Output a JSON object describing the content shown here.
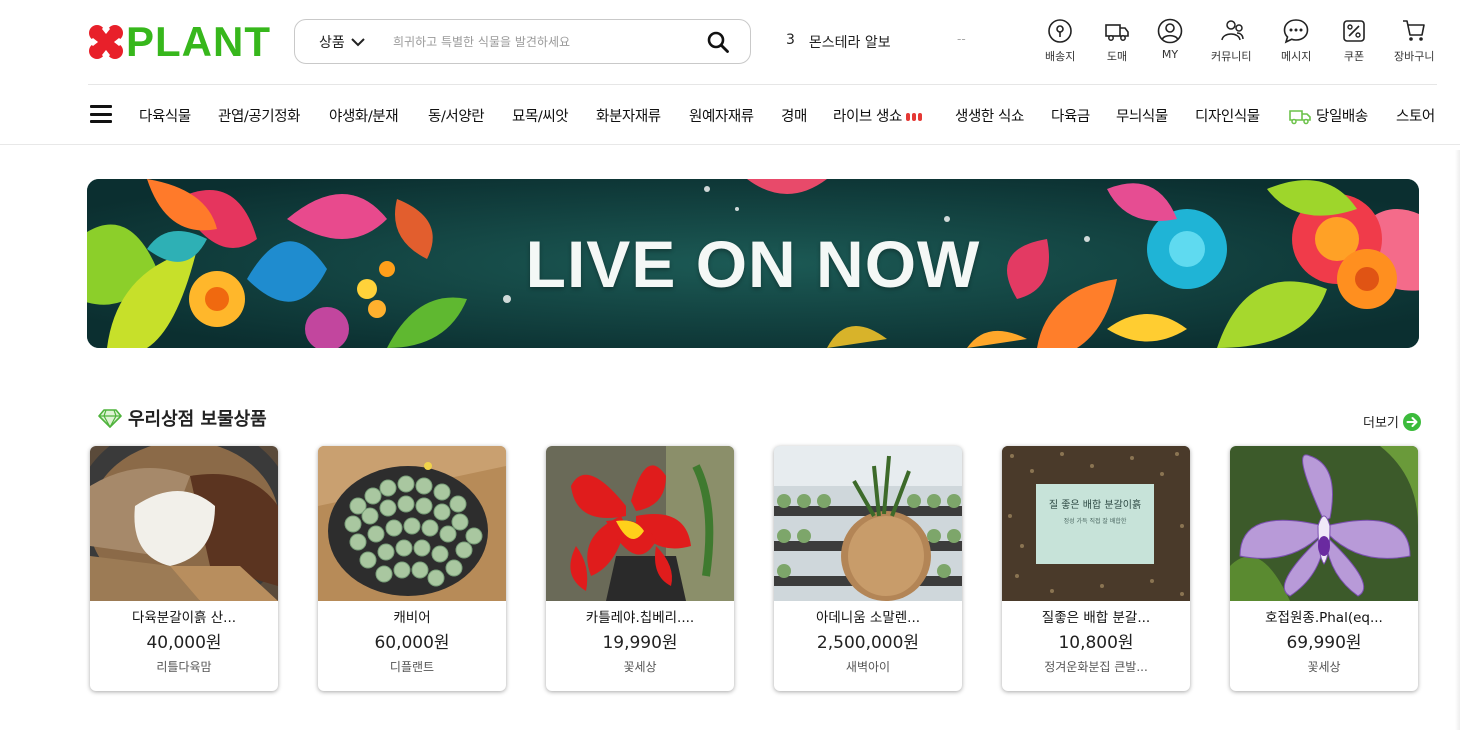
{
  "brand": {
    "logo_text": "PLANT",
    "accent": "#37b71c",
    "logo_x_color": "#e8202a"
  },
  "search": {
    "category": "상품",
    "placeholder": "희귀하고 특별한 식물을 발견하세요"
  },
  "trending": {
    "rank": "3",
    "keyword": "몬스테라 알보",
    "separator": "--"
  },
  "utility_menu": [
    {
      "label": "배송지",
      "icon": "map-pin-icon"
    },
    {
      "label": "도매",
      "icon": "truck-icon"
    },
    {
      "label": "MY",
      "icon": "user-icon"
    },
    {
      "label": "커뮤니티",
      "icon": "community-icon"
    },
    {
      "label": "메시지",
      "icon": "chat-icon"
    },
    {
      "label": "쿠폰",
      "icon": "coupon-icon"
    },
    {
      "label": "장바구니",
      "icon": "cart-icon"
    }
  ],
  "nav": {
    "items": [
      "다육식물",
      "관엽/공기정화",
      "야생화/분재",
      "동/서양란",
      "묘목/씨앗",
      "화분자재류",
      "원예자재류",
      "경매",
      "라이브 생쇼",
      "생생한 식쇼",
      "다육금",
      "무늬식물",
      "디자인식물",
      "당일배송",
      "스토어"
    ]
  },
  "banner": {
    "text": "LIVE ON NOW"
  },
  "section": {
    "title": "우리상점 보물상품",
    "more": "더보기"
  },
  "products": [
    {
      "name": "다육분갈이흙 산...",
      "price": "40,000원",
      "seller": "리틀다육맘"
    },
    {
      "name": "캐비어",
      "price": "60,000원",
      "seller": "디플랜트"
    },
    {
      "name": "카틀레야.칩베리....",
      "price": "19,990원",
      "seller": "꽃세상"
    },
    {
      "name": "아데니움 소말렌...",
      "price": "2,500,000원",
      "seller": "새벽아이"
    },
    {
      "name": "질좋은 배합 분갈...",
      "price": "10,800원",
      "seller": "정겨운화분집 큰발..."
    },
    {
      "name": "호접원종.Phal(eq...",
      "price": "69,990원",
      "seller": "꽃세상"
    }
  ],
  "product_image_text": {
    "soil_label": "질 좋은 배합 분갈이흙",
    "soil_sub": "정성 가득 직접 잘 배합한"
  }
}
